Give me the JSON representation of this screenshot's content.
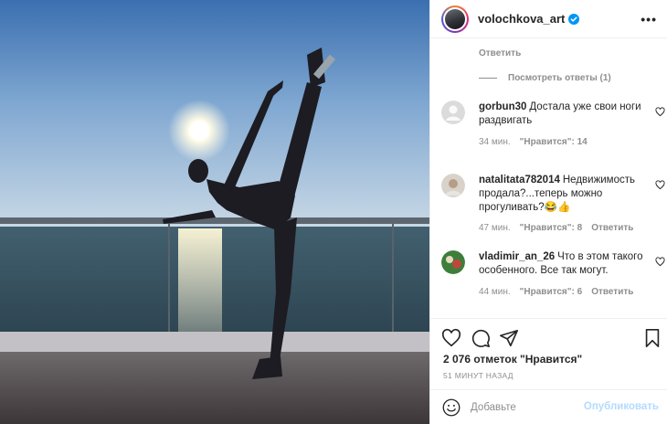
{
  "post": {
    "username": "volochkova_art",
    "verified": true,
    "more_label": "•••"
  },
  "comments_area": {
    "top_reply_label": "Ответить",
    "view_replies_label": "Посмотреть ответы (1)",
    "items": [
      {
        "username": "gorbun30",
        "text": "Достала уже свои ноги раздвигать",
        "time": "34 мин.",
        "likes": "\"Нравится\": 14",
        "reply": ""
      },
      {
        "username": "natalitata782014",
        "text": "Недвижимость продала?...теперь можно прогуливать?😂👍",
        "time": "47 мин.",
        "likes": "\"Нравится\": 8",
        "reply": "Ответить"
      },
      {
        "username": "vladimir_an_26",
        "text": "Что в этом такого особенного. Все так могут.",
        "time": "44 мин.",
        "likes": "\"Нравится\": 6",
        "reply": "Ответить"
      }
    ]
  },
  "actions": {
    "likes_text": "2 076 отметок \"Нравится\"",
    "posted_time": "51 МИНУТ НАЗАД",
    "icons": [
      "heart-icon",
      "comment-icon",
      "share-icon",
      "bookmark-icon"
    ]
  },
  "composer": {
    "placeholder": "Добавьте",
    "publish_label": "Опубликовать"
  },
  "colors": {
    "muted": "#8e8e8e",
    "text": "#262626",
    "publish_disabled": "#b3dbff",
    "verified_blue": "#0095f6"
  }
}
